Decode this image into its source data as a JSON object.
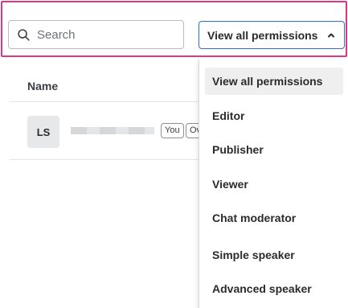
{
  "search": {
    "placeholder": "Search",
    "value": ""
  },
  "permission_filter": {
    "label": "View all permissions",
    "expanded": true
  },
  "table": {
    "headers": [
      "Name"
    ],
    "rows": [
      {
        "avatar_initials": "LS",
        "tags": [
          "You",
          "Ov"
        ]
      }
    ]
  },
  "dropdown": {
    "items": [
      {
        "label": "View all permissions",
        "selected": true
      },
      {
        "label": "Editor"
      },
      {
        "label": "Publisher"
      },
      {
        "label": "Viewer"
      },
      {
        "label": "Chat moderator"
      },
      {
        "label": "Simple speaker"
      },
      {
        "label": "Advanced speaker"
      }
    ]
  },
  "colors": {
    "highlight": "#e0377f",
    "dropdown_border": "#2e6fcf",
    "selected_bg": "#efeff0"
  }
}
